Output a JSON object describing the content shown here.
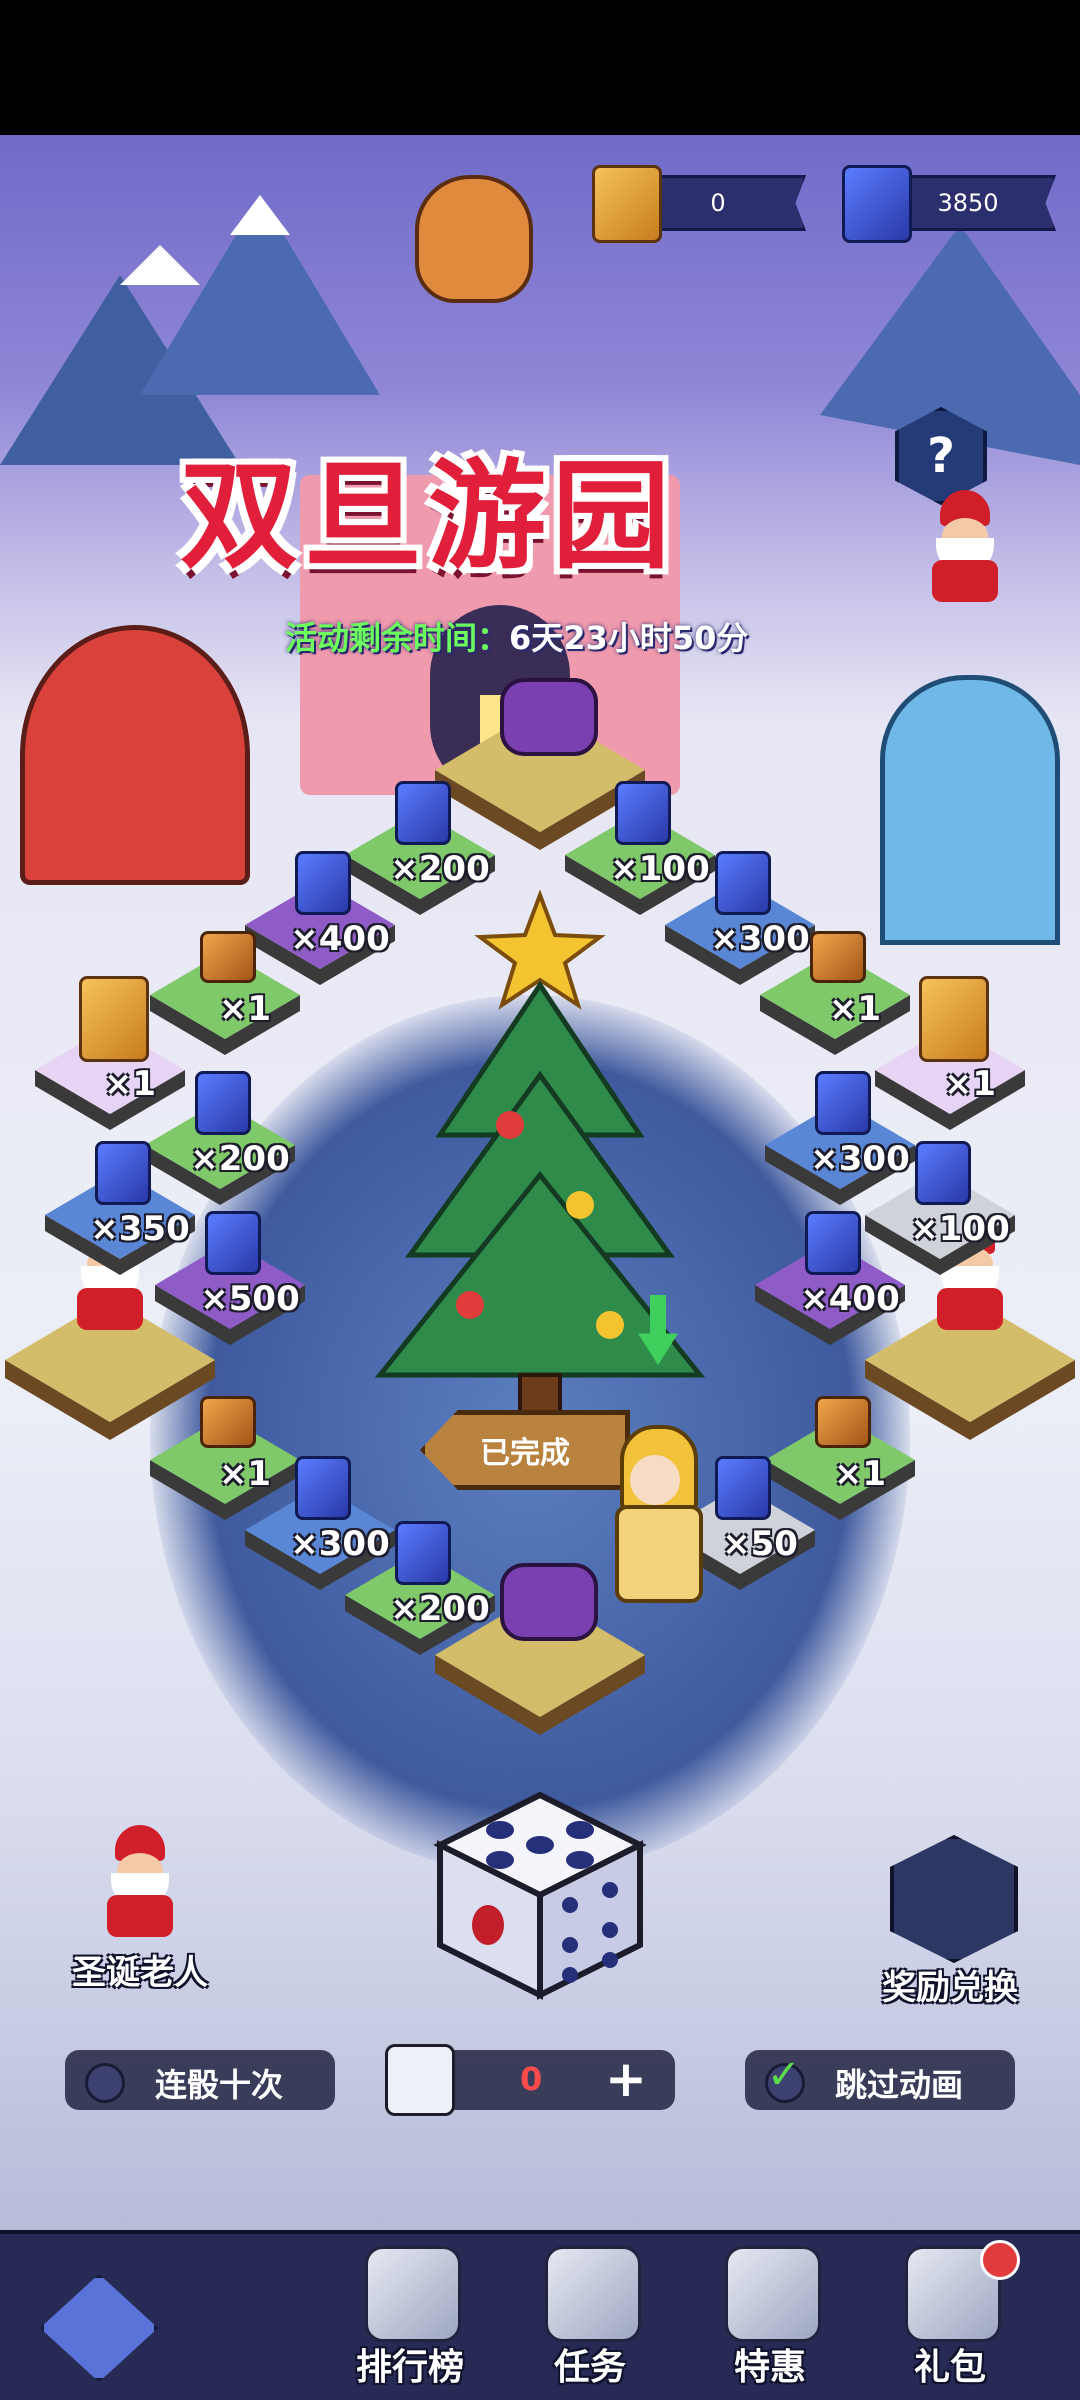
{
  "currencies": [
    {
      "name": "gold-scroll",
      "value": "0",
      "color": "#f6c15a"
    },
    {
      "name": "blue-scroll",
      "value": "3850",
      "color": "#4b68e8"
    }
  ],
  "title": "双旦游园",
  "timer": {
    "label": "活动剩余时间：",
    "value": "6天23小时50分"
  },
  "help_label": "?",
  "board": {
    "tiles": [
      {
        "label": "×200",
        "icon": "blue-scroll-icon",
        "color": "#7fc96a"
      },
      {
        "label": "×100",
        "icon": "blue-scroll-icon",
        "color": "#7fc96a"
      },
      {
        "label": "×400",
        "icon": "blue-scroll-icon",
        "color": "#8f5cc7"
      },
      {
        "label": "×300",
        "icon": "blue-scroll-icon",
        "color": "#5a86d6"
      },
      {
        "label": "×1",
        "icon": "chest-icon",
        "color": "#7fc96a"
      },
      {
        "label": "×1",
        "icon": "chest-icon",
        "color": "#7fc96a"
      },
      {
        "label": "×1",
        "icon": "gold-scroll-icon",
        "color": "#e7d4f4"
      },
      {
        "label": "×1",
        "icon": "gold-scroll-icon",
        "color": "#e7d4f4"
      },
      {
        "label": "×200",
        "icon": "blue-scroll-icon",
        "color": "#7fc96a"
      },
      {
        "label": "×300",
        "icon": "blue-scroll-icon",
        "color": "#5a86d6"
      },
      {
        "label": "×350",
        "icon": "blue-scroll-icon",
        "color": "#5a86d6"
      },
      {
        "label": "×100",
        "icon": "blue-scroll-icon",
        "color": "#cfd2d8"
      },
      {
        "label": "×500",
        "icon": "blue-scroll-icon",
        "color": "#8f5cc7"
      },
      {
        "label": "×400",
        "icon": "blue-scroll-icon",
        "color": "#8f5cc7"
      },
      {
        "label": "×1",
        "icon": "chest-icon",
        "color": "#7fc96a"
      },
      {
        "label": "×1",
        "icon": "chest-icon",
        "color": "#7fc96a"
      },
      {
        "label": "×300",
        "icon": "blue-scroll-icon",
        "color": "#5a86d6"
      },
      {
        "label": "×50",
        "icon": "blue-scroll-icon",
        "color": "#cfd2d8"
      },
      {
        "label": "×200",
        "icon": "blue-scroll-icon",
        "color": "#7fc96a"
      }
    ]
  },
  "signpost_text": "已完成",
  "left_button": {
    "label": "圣诞老人"
  },
  "right_button": {
    "label": "奖励兑换"
  },
  "options": {
    "roll_ten": "连骰十次",
    "dice_count": "0",
    "skip_animation": "跳过动画"
  },
  "nav": [
    {
      "label": "排行榜",
      "icon": "trophy-icon"
    },
    {
      "label": "任务",
      "icon": "task-icon"
    },
    {
      "label": "特惠",
      "icon": "lightning-icon"
    },
    {
      "label": "礼包",
      "icon": "gift-icon"
    }
  ]
}
